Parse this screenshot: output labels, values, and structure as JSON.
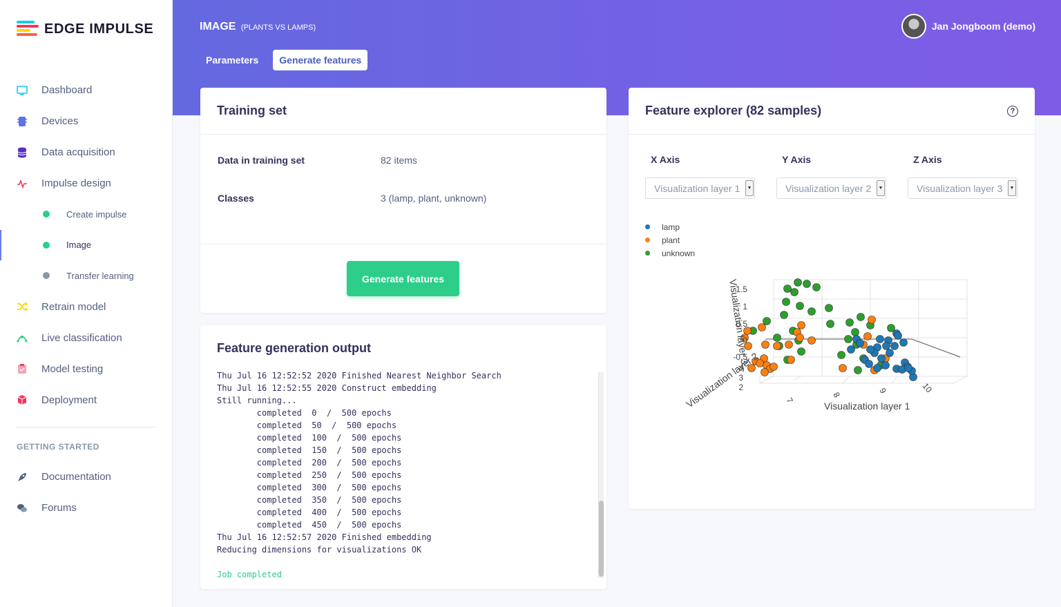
{
  "app": {
    "logo_text": "EDGE IMPULSE"
  },
  "sidebar": {
    "items": [
      {
        "label": "Dashboard",
        "icon": "monitor-icon",
        "color": "#11cdef"
      },
      {
        "label": "Devices",
        "icon": "chip-icon",
        "color": "#5e72e4"
      },
      {
        "label": "Data acquisition",
        "icon": "database-icon",
        "color": "#5b2fc2"
      },
      {
        "label": "Impulse design",
        "icon": "pulse-icon",
        "color": "#f5365c"
      }
    ],
    "subitems": [
      {
        "label": "Create impulse",
        "dot_color": "#2dce89"
      },
      {
        "label": "Image",
        "dot_color": "#2dce89"
      },
      {
        "label": "Transfer learning",
        "dot_color": "#8898aa"
      }
    ],
    "items_after": [
      {
        "label": "Retrain model",
        "icon": "shuffle-icon",
        "color": "#ffd600"
      },
      {
        "label": "Live classification",
        "icon": "antenna-icon",
        "color": "#2dce89"
      },
      {
        "label": "Model testing",
        "icon": "clipboard-icon",
        "color": "#f3a4b5"
      },
      {
        "label": "Deployment",
        "icon": "cube-icon",
        "color": "#f5365c"
      }
    ],
    "section_label": "GETTING STARTED",
    "help_items": [
      {
        "label": "Documentation",
        "icon": "rocket-icon"
      },
      {
        "label": "Forums",
        "icon": "chat-icon"
      }
    ]
  },
  "header": {
    "title": "IMAGE",
    "subtitle": "(PLANTS VS LAMPS)",
    "tabs": [
      "Parameters",
      "Generate features"
    ],
    "user_name": "Jan Jongboom (demo)"
  },
  "training": {
    "title": "Training set",
    "rows": [
      {
        "key": "Data in training set",
        "value": "82 items"
      },
      {
        "key": "Classes",
        "value": "3 (lamp, plant, unknown)"
      }
    ],
    "button": "Generate features"
  },
  "output": {
    "title": "Feature generation output",
    "lines": [
      "Thu Jul 16 12:52:52 2020 Finished Nearest Neighbor Search",
      "Thu Jul 16 12:52:55 2020 Construct embedding",
      "Still running...",
      "        completed  0  /  500 epochs",
      "        completed  50  /  500 epochs",
      "        completed  100  /  500 epochs",
      "        completed  150  /  500 epochs",
      "        completed  200  /  500 epochs",
      "        completed  250  /  500 epochs",
      "        completed  300  /  500 epochs",
      "        completed  350  /  500 epochs",
      "        completed  400  /  500 epochs",
      "        completed  450  /  500 epochs",
      "Thu Jul 16 12:52:57 2020 Finished embedding",
      "Reducing dimensions for visualizations OK",
      ""
    ],
    "status": "Job completed"
  },
  "explorer": {
    "title": "Feature explorer (82 samples)",
    "axes": [
      {
        "label": "X Axis",
        "value": "Visualization layer 1"
      },
      {
        "label": "Y Axis",
        "value": "Visualization layer 2"
      },
      {
        "label": "Z Axis",
        "value": "Visualization layer 3"
      }
    ]
  },
  "chart_data": {
    "type": "scatter",
    "dimensions": 3,
    "series": [
      {
        "name": "lamp",
        "color": "#1f77b4",
        "count": 26
      },
      {
        "name": "plant",
        "color": "#ff7f0e",
        "count": 26
      },
      {
        "name": "unknown",
        "color": "#2ca02c",
        "count": 30
      }
    ],
    "axis_labels": {
      "x": "Visualization layer 1",
      "y": "Visualization layer 2",
      "z": "Visualization layer 3"
    },
    "x_ticks": [
      "7",
      "8",
      "9",
      "10"
    ],
    "y_ticks": [
      "2",
      "3",
      "4"
    ],
    "z_ticks": [
      "1.5",
      "1",
      "0.5",
      "0",
      "-0.5"
    ],
    "points_projected": [
      [
        170,
        17,
        "u"
      ],
      [
        185,
        8,
        "u"
      ],
      [
        198,
        10,
        "u"
      ],
      [
        212,
        15,
        "u"
      ],
      [
        180,
        22,
        "u"
      ],
      [
        168,
        36,
        "u"
      ],
      [
        188,
        42,
        "u"
      ],
      [
        230,
        45,
        "u"
      ],
      [
        165,
        55,
        "u"
      ],
      [
        205,
        50,
        "u"
      ],
      [
        232,
        68,
        "u"
      ],
      [
        260,
        66,
        "u"
      ],
      [
        276,
        58,
        "u"
      ],
      [
        140,
        64,
        "u"
      ],
      [
        120,
        78,
        "u"
      ],
      [
        155,
        88,
        "u"
      ],
      [
        178,
        78,
        "u"
      ],
      [
        186,
        92,
        "u"
      ],
      [
        268,
        80,
        "u"
      ],
      [
        290,
        70,
        "u"
      ],
      [
        258,
        90,
        "u"
      ],
      [
        270,
        98,
        "u"
      ],
      [
        320,
        74,
        "u"
      ],
      [
        248,
        113,
        "u"
      ],
      [
        280,
        118,
        "u"
      ],
      [
        305,
        128,
        "u"
      ],
      [
        272,
        135,
        "u"
      ],
      [
        190,
        108,
        "u"
      ],
      [
        170,
        120,
        "u"
      ],
      [
        158,
        100,
        "u"
      ],
      [
        190,
        70,
        "p"
      ],
      [
        184,
        80,
        "p"
      ],
      [
        133,
        73,
        "p"
      ],
      [
        112,
        78,
        "p"
      ],
      [
        108,
        88,
        "p"
      ],
      [
        113,
        100,
        "p"
      ],
      [
        138,
        98,
        "p"
      ],
      [
        155,
        100,
        "p"
      ],
      [
        172,
        98,
        "p"
      ],
      [
        188,
        88,
        "p"
      ],
      [
        205,
        92,
        "p"
      ],
      [
        136,
        118,
        "p"
      ],
      [
        124,
        122,
        "p"
      ],
      [
        140,
        128,
        "p"
      ],
      [
        175,
        120,
        "p"
      ],
      [
        118,
        132,
        "p"
      ],
      [
        145,
        133,
        "p"
      ],
      [
        137,
        138,
        "p"
      ],
      [
        250,
        132,
        "p"
      ],
      [
        286,
        86,
        "p"
      ],
      [
        292,
        62,
        "p"
      ],
      [
        296,
        135,
        "p"
      ],
      [
        312,
        118,
        "p"
      ],
      [
        150,
        130,
        "p"
      ],
      [
        280,
        98,
        "p"
      ],
      [
        130,
        125,
        "p"
      ],
      [
        328,
        82,
        "l"
      ],
      [
        338,
        95,
        "l"
      ],
      [
        304,
        90,
        "l"
      ],
      [
        316,
        92,
        "l"
      ],
      [
        325,
        100,
        "l"
      ],
      [
        270,
        90,
        "l"
      ],
      [
        275,
        96,
        "l"
      ],
      [
        262,
        105,
        "l"
      ],
      [
        300,
        102,
        "l"
      ],
      [
        296,
        110,
        "l"
      ],
      [
        282,
        120,
        "l"
      ],
      [
        300,
        132,
        "l"
      ],
      [
        312,
        128,
        "l"
      ],
      [
        328,
        133,
        "l"
      ],
      [
        340,
        124,
        "l"
      ],
      [
        344,
        130,
        "l"
      ],
      [
        352,
        145,
        "l"
      ],
      [
        350,
        136,
        "l"
      ],
      [
        336,
        134,
        "l"
      ],
      [
        306,
        118,
        "l"
      ],
      [
        318,
        110,
        "l"
      ],
      [
        330,
        85,
        "l"
      ],
      [
        288,
        126,
        "l"
      ],
      [
        290,
        105,
        "l"
      ],
      [
        313,
        100,
        "l"
      ],
      [
        345,
        132,
        "l"
      ]
    ]
  }
}
